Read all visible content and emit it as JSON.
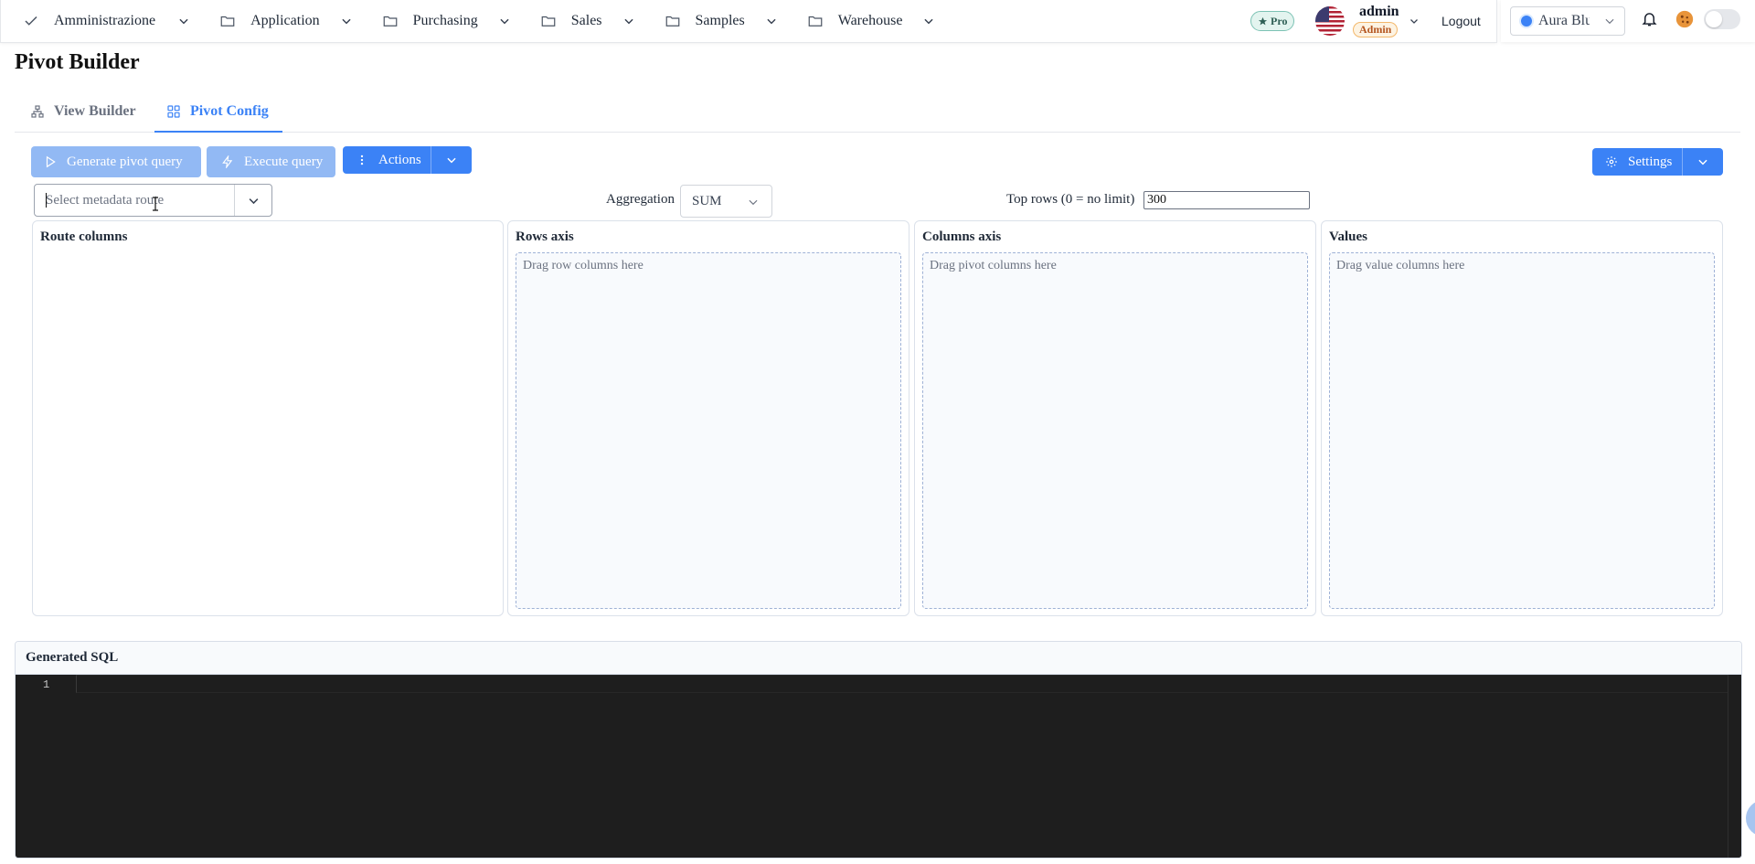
{
  "nav": {
    "menus": [
      {
        "label": "Amministrazione",
        "icon": "check-icon"
      },
      {
        "label": "Application",
        "icon": "folder-icon"
      },
      {
        "label": "Purchasing",
        "icon": "folder-icon"
      },
      {
        "label": "Sales",
        "icon": "folder-icon"
      },
      {
        "label": "Samples",
        "icon": "folder-icon"
      },
      {
        "label": "Warehouse",
        "icon": "folder-icon"
      }
    ],
    "pro_badge": "Pro",
    "user": {
      "name": "admin",
      "role": "Admin"
    },
    "logout": "Logout",
    "theme": "Aura Blue"
  },
  "page": {
    "title": "Pivot Builder",
    "tabs": [
      {
        "label": "View Builder",
        "active": false
      },
      {
        "label": "Pivot Config",
        "active": true
      }
    ]
  },
  "toolbar": {
    "generate": "Generate pivot query",
    "execute": "Execute query",
    "actions": "Actions",
    "settings": "Settings"
  },
  "controls": {
    "route_placeholder": "Select metadata route",
    "aggregation_label": "Aggregation",
    "aggregation_value": "SUM",
    "top_rows_label": "Top rows (0 = no limit)",
    "top_rows_value": "300"
  },
  "panels": {
    "route_columns": {
      "title": "Route columns"
    },
    "rows_axis": {
      "title": "Rows axis",
      "hint": "Drag row columns here"
    },
    "columns_axis": {
      "title": "Columns axis",
      "hint": "Drag pivot columns here"
    },
    "values": {
      "title": "Values",
      "hint": "Drag value columns here"
    }
  },
  "sql": {
    "title": "Generated SQL",
    "line_numbers": [
      "1"
    ],
    "content": ""
  },
  "colors": {
    "accent": "#3b82f6",
    "accent_disabled": "#92b9f4",
    "editor_bg": "#1e1e1e"
  }
}
